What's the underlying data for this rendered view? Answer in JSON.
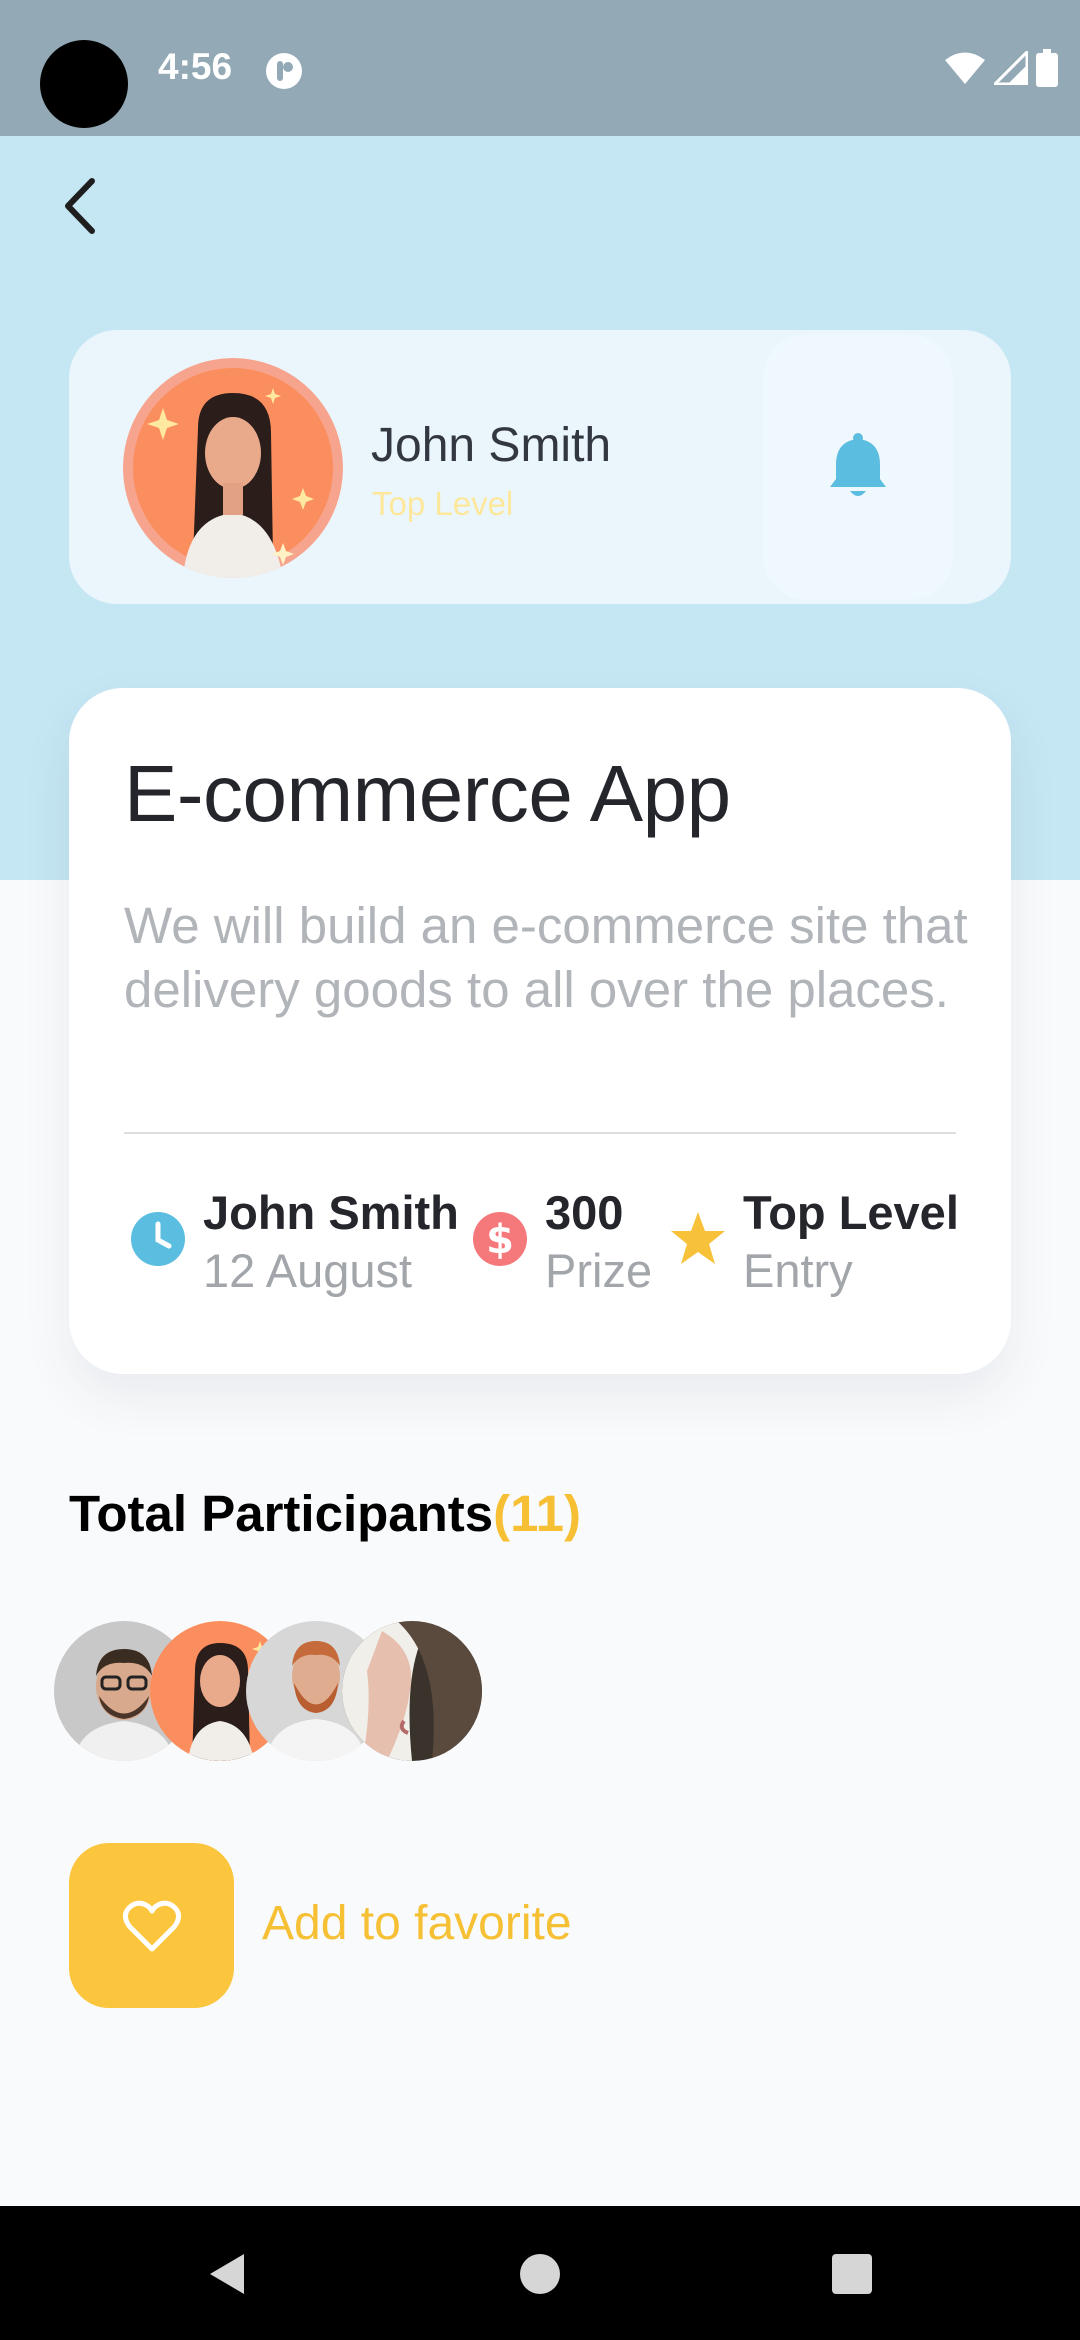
{
  "status_bar": {
    "time": "4:56",
    "icons": [
      "camera-hole",
      "app-notification-icon",
      "wifi-icon",
      "signal-icon",
      "battery-icon"
    ]
  },
  "header": {
    "back_icon": "chevron-left-icon"
  },
  "profile": {
    "name": "John Smith",
    "level": "Top Level",
    "bell_icon": "bell-icon"
  },
  "project": {
    "title": "E-commerce App",
    "description": "We will build an e-commerce site that delivery goods to all over the places.",
    "stats": [
      {
        "icon": "clock-icon",
        "main": "John Smith",
        "sub": "12 August",
        "color": "#5bbde0"
      },
      {
        "icon": "dollar-icon",
        "main": "300",
        "sub": "Prize",
        "color": "#f5787a"
      },
      {
        "icon": "star-icon",
        "main": "Top Level",
        "sub": "Entry",
        "color": "#f7c13a"
      }
    ]
  },
  "participants": {
    "title": "Total Participants",
    "count": "(11)"
  },
  "favorite": {
    "label": "Add to favorite",
    "icon": "heart-outline-icon"
  },
  "colors": {
    "header_bg": "#c5e6f3",
    "accent_yellow": "#fbc63d",
    "bell_blue": "#5bbde0"
  }
}
